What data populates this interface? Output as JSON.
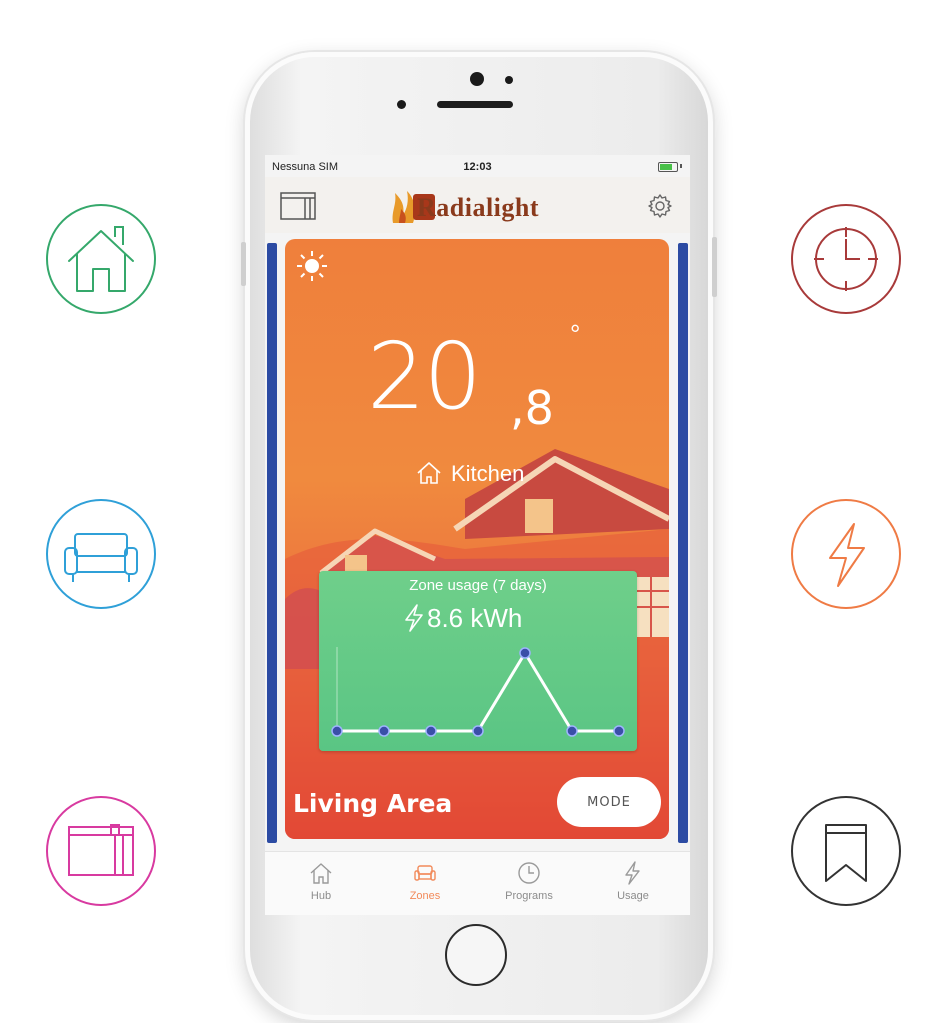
{
  "status_bar": {
    "carrier": "Nessuna SIM",
    "time": "12:03",
    "battery_level": 0.75
  },
  "header": {
    "logo_text": "Radialight",
    "logo_mark": "R",
    "menu_icon": "sidebar-panel-icon",
    "settings_icon": "gear-icon"
  },
  "zone": {
    "mode_icon": "sun-icon",
    "temperature_whole": "20",
    "temperature_decimal": ",8",
    "temperature_unit": "°",
    "room_icon": "house-icon",
    "room": "Kitchen",
    "usage": {
      "title": "Zone usage (7 days)",
      "value": "8.6 kWh",
      "icon": "bolt-icon"
    },
    "area_name": "Living Area",
    "mode_button": "MODE"
  },
  "chart_data": {
    "type": "line",
    "x": [
      1,
      2,
      3,
      4,
      5,
      6,
      7
    ],
    "series": [
      {
        "values": [
          0,
          0,
          0,
          0,
          8.6,
          0,
          0
        ]
      }
    ],
    "title": "Zone usage (7 days)",
    "grid": false
  },
  "tabs": [
    {
      "label": "Hub",
      "icon": "house-icon",
      "active": false
    },
    {
      "label": "Zones",
      "icon": "sofa-icon",
      "active": true
    },
    {
      "label": "Programs",
      "icon": "clock-icon",
      "active": false
    },
    {
      "label": "Usage",
      "icon": "bolt-icon",
      "active": false
    }
  ],
  "feature_icons": {
    "left": [
      "house-icon",
      "sofa-icon",
      "sidebar-panel-icon"
    ],
    "right": [
      "clock-icon",
      "bolt-icon",
      "bookmark-icon"
    ]
  },
  "colors": {
    "accent": "#f28a5a",
    "house_green": "#35a86b",
    "sofa_blue": "#2fa0d8",
    "panel_magenta": "#d83aa0",
    "clock_red": "#a83a3a",
    "bolt_orange": "#ef7b45",
    "bookmark_dark": "#333333",
    "card_orange": "#ef7f3c",
    "card_red": "#dd2f2c",
    "usage_green": "#5ac584",
    "carousel_blue": "#2c4ba3"
  }
}
